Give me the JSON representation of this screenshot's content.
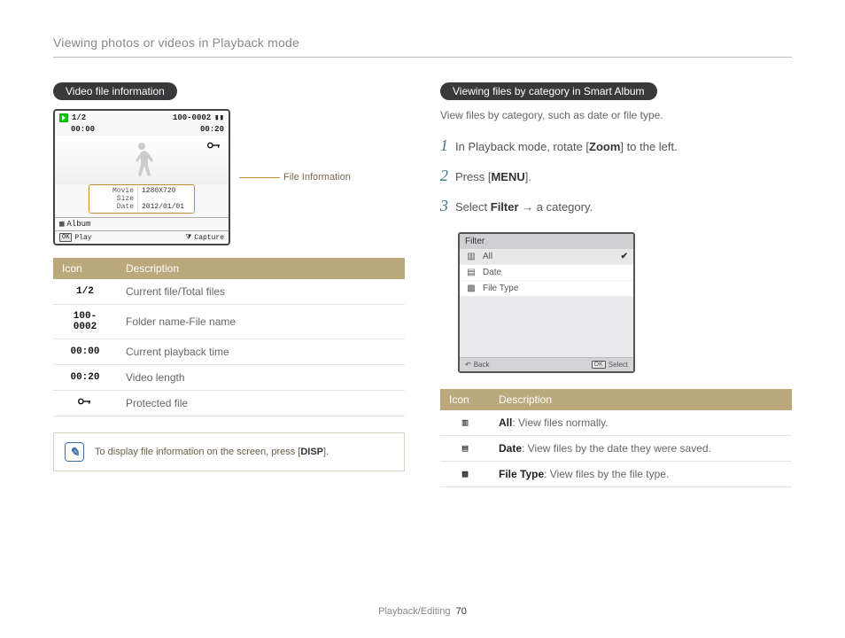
{
  "page": {
    "header": "Viewing photos or videos in Playback mode",
    "footer_section": "Playback/Editing",
    "footer_page": "70"
  },
  "left": {
    "section_title": "Video file information",
    "lcd": {
      "file_counter": "1/2",
      "file_id": "100-0002",
      "time_current": "00:00",
      "time_total": "00:20",
      "info_movie_size_label": "Movie Size",
      "info_movie_size_value": "1280X720",
      "info_date_label": "Date",
      "info_date_value": "2012/01/01",
      "album_label": "Album",
      "play_label": "Play",
      "capture_label": "Capture",
      "ok_box": "OK"
    },
    "callout": "File Information",
    "table_header_icon": "Icon",
    "table_header_desc": "Description",
    "rows": [
      {
        "icon": "1/2",
        "desc": "Current file/Total files"
      },
      {
        "icon": "100-0002",
        "desc": "Folder name-File name"
      },
      {
        "icon": "00:00",
        "desc": "Current playback time"
      },
      {
        "icon": "00:20",
        "desc": "Video length"
      },
      {
        "icon": "KEY",
        "desc": "Protected file"
      }
    ],
    "tip_prefix": "To display file information on the screen, press [",
    "tip_btn": "DISP",
    "tip_suffix": "]."
  },
  "right": {
    "section_title": "Viewing files by category in Smart Album",
    "subtext": "View files by category, such as date or file type.",
    "step1_prefix": "In Playback mode, rotate [",
    "step1_bold": "Zoom",
    "step1_suffix": "] to the left.",
    "step2_prefix": "Press [",
    "step2_bold": "MENU",
    "step2_suffix": "].",
    "step3_prefix": "Select ",
    "step3_bold": "Filter",
    "step3_mid": " → a category.",
    "filter": {
      "title": "Filter",
      "row_all": "All",
      "row_date": "Date",
      "row_filetype": "File Type",
      "back": "Back",
      "select": "Select",
      "ok_box": "OK"
    },
    "table_header_icon": "Icon",
    "table_header_desc": "Description",
    "desc_rows": {
      "all_bold": "All",
      "all_rest": ": View files normally.",
      "date_bold": "Date",
      "date_rest": ": View files by the date they were saved.",
      "ft_bold": "File Type",
      "ft_rest": ": View files by the file type."
    }
  }
}
